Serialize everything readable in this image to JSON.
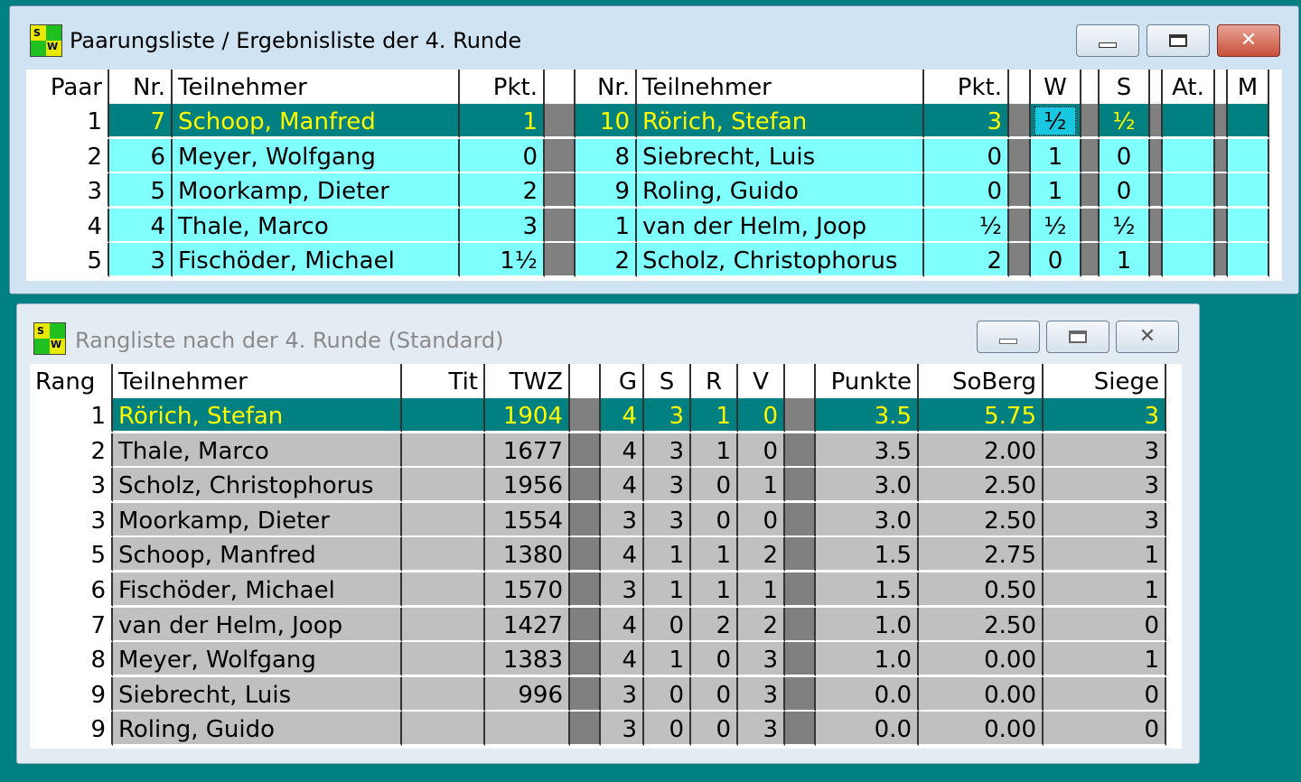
{
  "pairings_window": {
    "title": "Paarungsliste / Ergebnisliste der 4. Runde",
    "icon": "sw-app-icon",
    "icon_letters": [
      "S",
      "W"
    ],
    "headers": [
      "Paar",
      "Nr.",
      "Teilnehmer",
      "Pkt.",
      "",
      "Nr.",
      "Teilnehmer",
      "Pkt.",
      "",
      "W",
      "",
      "S",
      "",
      "At.",
      "",
      "M"
    ],
    "rows": [
      {
        "paar": "1",
        "nr1": "7",
        "name1": "Schoop, Manfred",
        "pkt1": "1",
        "nr2": "10",
        "name2": "Rörich, Stefan",
        "pkt2": "3",
        "w": "½",
        "s": "½",
        "at": "",
        "m": ""
      },
      {
        "paar": "2",
        "nr1": "6",
        "name1": "Meyer, Wolfgang",
        "pkt1": "0",
        "nr2": "8",
        "name2": "Siebrecht, Luis",
        "pkt2": "0",
        "w": "1",
        "s": "0",
        "at": "",
        "m": ""
      },
      {
        "paar": "3",
        "nr1": "5",
        "name1": "Moorkamp, Dieter",
        "pkt1": "2",
        "nr2": "9",
        "name2": "Roling, Guido",
        "pkt2": "0",
        "w": "1",
        "s": "0",
        "at": "",
        "m": ""
      },
      {
        "paar": "4",
        "nr1": "4",
        "name1": "Thale, Marco",
        "pkt1": "3",
        "nr2": "1",
        "name2": "van der Helm, Joop",
        "pkt2": "½",
        "w": "½",
        "s": "½",
        "at": "",
        "m": ""
      },
      {
        "paar": "5",
        "nr1": "3",
        "name1": "Fischöder, Michael",
        "pkt1": "1½",
        "nr2": "2",
        "name2": "Scholz, Christophorus",
        "pkt2": "2",
        "w": "0",
        "s": "1",
        "at": "",
        "m": ""
      }
    ]
  },
  "ranking_window": {
    "title": "Rangliste nach der 4. Runde (Standard)",
    "icon": "sw-app-icon",
    "icon_letters": [
      "S",
      "W"
    ],
    "headers": [
      "Rang",
      "Teilnehmer",
      "Tit",
      "TWZ",
      "",
      "G",
      "S",
      "R",
      "V",
      "",
      "Punkte",
      "SoBerg",
      "Siege"
    ],
    "rows": [
      {
        "rang": "1",
        "name": "Rörich, Stefan",
        "tit": "",
        "twz": "1904",
        "g": "4",
        "s": "3",
        "r": "1",
        "v": "0",
        "punkte": "3.5",
        "soberg": "5.75",
        "siege": "3"
      },
      {
        "rang": "2",
        "name": "Thale, Marco",
        "tit": "",
        "twz": "1677",
        "g": "4",
        "s": "3",
        "r": "1",
        "v": "0",
        "punkte": "3.5",
        "soberg": "2.00",
        "siege": "3"
      },
      {
        "rang": "3",
        "name": "Scholz, Christophorus",
        "tit": "",
        "twz": "1956",
        "g": "4",
        "s": "3",
        "r": "0",
        "v": "1",
        "punkte": "3.0",
        "soberg": "2.50",
        "siege": "3"
      },
      {
        "rang": "3",
        "name": "Moorkamp, Dieter",
        "tit": "",
        "twz": "1554",
        "g": "3",
        "s": "3",
        "r": "0",
        "v": "0",
        "punkte": "3.0",
        "soberg": "2.50",
        "siege": "3"
      },
      {
        "rang": "5",
        "name": "Schoop, Manfred",
        "tit": "",
        "twz": "1380",
        "g": "4",
        "s": "1",
        "r": "1",
        "v": "2",
        "punkte": "1.5",
        "soberg": "2.75",
        "siege": "1"
      },
      {
        "rang": "6",
        "name": "Fischöder, Michael",
        "tit": "",
        "twz": "1570",
        "g": "3",
        "s": "1",
        "r": "1",
        "v": "1",
        "punkte": "1.5",
        "soberg": "0.50",
        "siege": "1"
      },
      {
        "rang": "7",
        "name": "van der Helm, Joop",
        "tit": "",
        "twz": "1427",
        "g": "4",
        "s": "0",
        "r": "2",
        "v": "2",
        "punkte": "1.0",
        "soberg": "2.50",
        "siege": "0"
      },
      {
        "rang": "8",
        "name": "Meyer, Wolfgang",
        "tit": "",
        "twz": "1383",
        "g": "4",
        "s": "1",
        "r": "0",
        "v": "3",
        "punkte": "1.0",
        "soberg": "0.00",
        "siege": "1"
      },
      {
        "rang": "9",
        "name": "Siebrecht, Luis",
        "tit": "",
        "twz": "996",
        "g": "3",
        "s": "0",
        "r": "0",
        "v": "3",
        "punkte": "0.0",
        "soberg": "0.00",
        "siege": "0"
      },
      {
        "rang": "9",
        "name": "Roling, Guido",
        "tit": "",
        "twz": "",
        "g": "3",
        "s": "0",
        "r": "0",
        "v": "3",
        "punkte": "0.0",
        "soberg": "0.00",
        "siege": "0"
      }
    ]
  },
  "window_controls": [
    "minimize-icon",
    "maximize-icon",
    "close-icon"
  ],
  "colors": {
    "desktop": "#008080",
    "selected_row_bg": "#008080",
    "selected_row_text": "#ffff00",
    "pairings_row_bg": "#80ffff",
    "ranking_row_bg": "#c0c0c0",
    "separator_gray": "#808080",
    "close_button": "#c7503a"
  }
}
